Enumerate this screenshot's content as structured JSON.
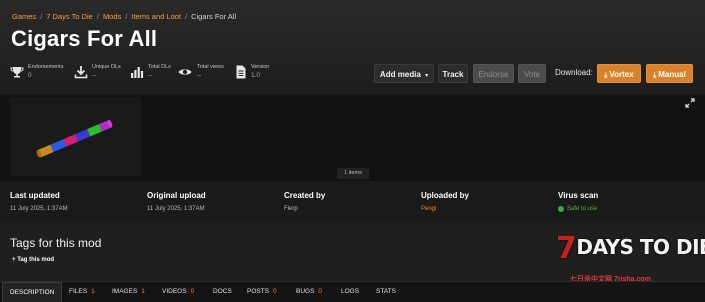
{
  "breadcrumb": [
    "Games",
    "7 Days To Die",
    "Mods",
    "Items and Loot",
    "Cigars For All"
  ],
  "title": "Cigars For All",
  "stats": [
    {
      "label": "Endorsements",
      "value": "0",
      "icon": "trophy-icon"
    },
    {
      "label": "Unique DLs",
      "value": "--",
      "icon": "download-icon"
    },
    {
      "label": "Total DLs",
      "value": "--",
      "icon": "bar-chart-icon"
    },
    {
      "label": "Total views",
      "value": "--",
      "icon": "eye-icon"
    },
    {
      "label": "Version",
      "value": "1.0",
      "icon": "document-icon"
    }
  ],
  "actions": {
    "add_media": "Add media",
    "track": "Track",
    "endorse": "Endorse",
    "vote": "Vote",
    "download_label": "Download:",
    "vortex": "Vortex",
    "manual": "Manual"
  },
  "media": {
    "items_count": "1 items"
  },
  "meta": [
    {
      "title": "Last updated",
      "value": "11 July 2025, 1:37AM"
    },
    {
      "title": "Original upload",
      "value": "11 July 2025, 1:37AM"
    },
    {
      "title": "Created by",
      "value": "Flerp"
    },
    {
      "title": "Uploaded by",
      "value": "Pengi"
    },
    {
      "title": "Virus scan",
      "value": "Safe to use"
    }
  ],
  "tags": {
    "heading": "Tags for this mod",
    "tag_button": "Tag this mod"
  },
  "logo": {
    "main": "DAYS TO DIE",
    "seven": "7",
    "sub": "七日杀中文网 7risha.com"
  },
  "tabs": [
    {
      "label": "DESCRIPTION",
      "count": ""
    },
    {
      "label": "FILES",
      "count": "1"
    },
    {
      "label": "IMAGES",
      "count": "1"
    },
    {
      "label": "VIDEOS",
      "count": "0"
    },
    {
      "label": "DOCS",
      "count": ""
    },
    {
      "label": "POSTS",
      "count": "0"
    },
    {
      "label": "BUGS",
      "count": "0"
    },
    {
      "label": "LOGS",
      "count": ""
    },
    {
      "label": "STATS",
      "count": ""
    }
  ],
  "colors": {
    "accent": "#d9822b",
    "link": "#f0a040",
    "safe": "#5fb040",
    "logo_red": "#c32222"
  }
}
